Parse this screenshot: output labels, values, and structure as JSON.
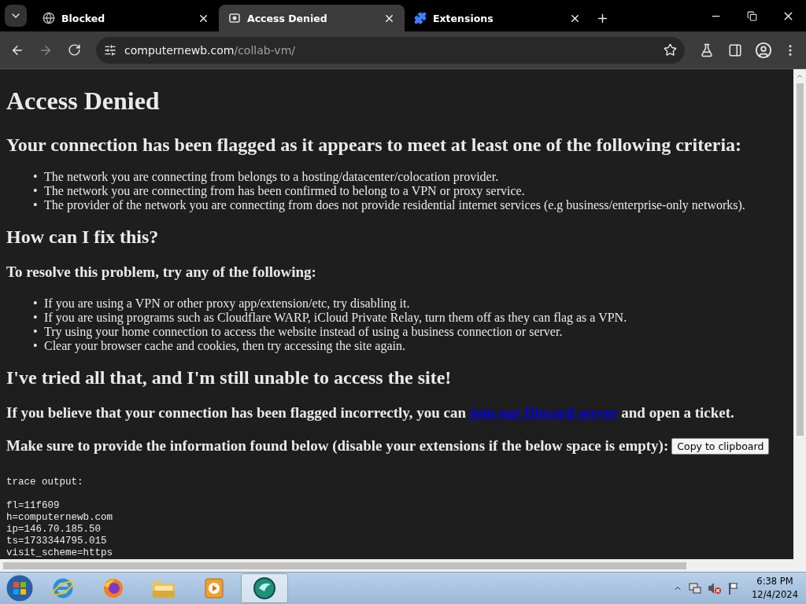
{
  "tabs": [
    {
      "title": "Blocked",
      "kind": "globe",
      "selected": false
    },
    {
      "title": "Access Denied",
      "kind": "page",
      "selected": true
    },
    {
      "title": "Extensions",
      "kind": "puzzle",
      "selected": false
    }
  ],
  "address": {
    "host": "computernewb.com",
    "path": "/collab-vm/"
  },
  "page": {
    "title": "Access Denied",
    "criteria_heading": "Your connection has been flagged as it appears to meet at least one of the following criteria:",
    "bullet": "•",
    "criteria": [
      "The network you are connecting from belongs to a hosting/datacenter/colocation provider.",
      "The network you are connecting from has been confirmed to belong to a VPN or proxy service.",
      "The provider of the network you are connecting from does not provide residential internet services (e.g business/enterprise-only networks)."
    ],
    "fix_heading": "How can I fix this?",
    "resolve_heading": "To resolve this problem, try any of the following:",
    "steps": [
      "If you are using a VPN or other proxy app/extension/etc, try disabling it.",
      "If you are using programs such as Cloudflare WARP, iCloud Private Relay, turn them off as they can flag as a VPN.",
      "Try using your home connection to access the website instead of using a business connection or server.",
      "Clear your browser cache and cookies, then try accessing the site again."
    ],
    "tried_heading": "I've tried all that, and I'm still unable to access the site!",
    "report": {
      "before": "If you believe that your connection has been flagged incorrectly, you can ",
      "link": "join our Discord server",
      "after": " and open a ticket."
    },
    "info": {
      "text": "Make sure to provide the information found below (disable your extensions if the below space is empty):",
      "button": "Copy to clipboard"
    },
    "trace": {
      "label": "trace output:",
      "lines": [
        "fl=11f609",
        "h=computernewb.com",
        "ip=146.70.185.50",
        "ts=1733344795.015",
        "visit_scheme=https"
      ]
    }
  },
  "taskbar": {
    "apps": [
      {
        "kind": "ie",
        "selected": false
      },
      {
        "kind": "firefox",
        "selected": false
      },
      {
        "kind": "folder",
        "selected": false
      },
      {
        "kind": "media",
        "selected": false
      },
      {
        "kind": "vm",
        "selected": true
      }
    ],
    "clock": {
      "time": "6:38 PM",
      "date": "12/4/2024"
    }
  }
}
